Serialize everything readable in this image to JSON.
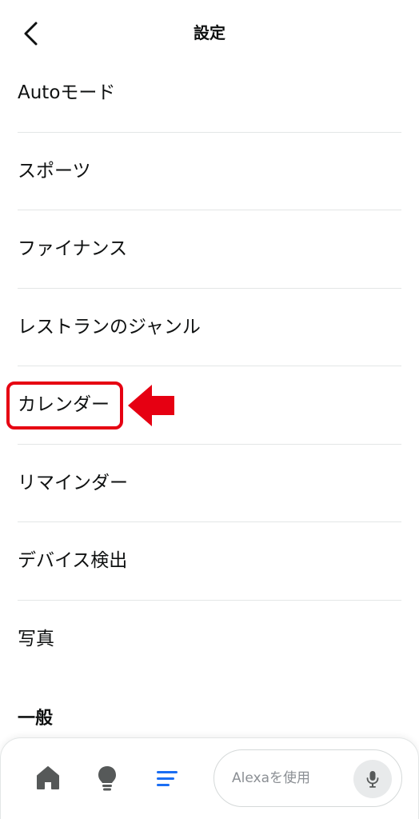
{
  "header": {
    "title": "設定"
  },
  "menu": {
    "items": [
      {
        "label": "Autoモード"
      },
      {
        "label": "スポーツ"
      },
      {
        "label": "ファイナンス"
      },
      {
        "label": "レストランのジャンル"
      },
      {
        "label": "カレンダー",
        "highlighted": true
      },
      {
        "label": "リマインダー"
      },
      {
        "label": "デバイス検出"
      },
      {
        "label": "写真"
      }
    ]
  },
  "section": {
    "title": "一般"
  },
  "bottom_nav": {
    "items": [
      {
        "icon": "home-icon"
      },
      {
        "icon": "lightbulb-icon"
      },
      {
        "icon": "more-menu-icon",
        "active": true
      }
    ],
    "alexa_placeholder": "Alexaを使用",
    "mic_icon": "microphone-icon"
  },
  "colors": {
    "highlight": "#e60012",
    "active_nav": "#1b6ef3",
    "inactive_nav": "#565959",
    "divider": "#e3e6e6"
  }
}
